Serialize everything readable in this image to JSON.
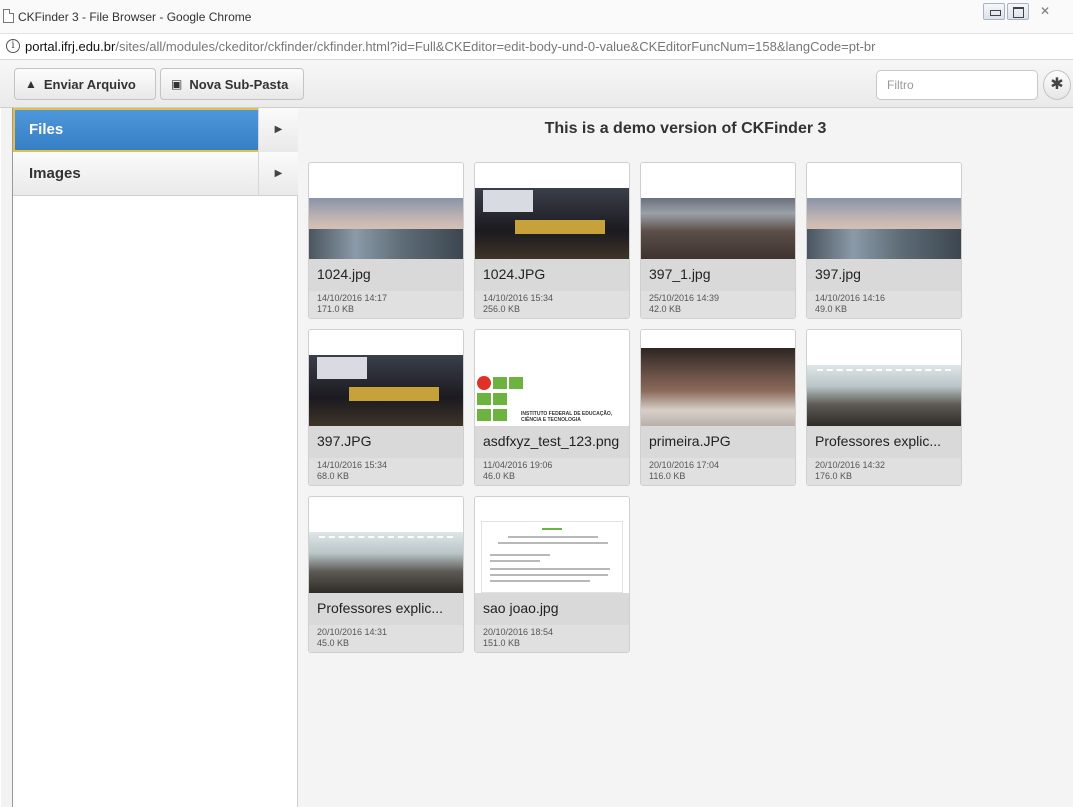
{
  "window": {
    "title": "CKFinder 3 - File Browser - Google Chrome",
    "close_glyph": "✕"
  },
  "address": {
    "host": "portal.ifrj.edu.br",
    "path": "/sites/all/modules/ckeditor/ckfinder/ckfinder.html?id=Full&CKEditor=edit-body-und-0-value&CKEditorFuncNum=158&langCode=pt-br"
  },
  "toolbar": {
    "upload_label": "Enviar Arquivo",
    "upload_icon": "upload-icon",
    "new_folder_label": "Nova Sub-Pasta",
    "new_folder_icon": "folder-add-icon",
    "filter_placeholder": "Filtro",
    "settings_icon": "gear-icon"
  },
  "sidebar": {
    "folders": [
      {
        "label": "Files",
        "active": true
      },
      {
        "label": "Images",
        "active": false
      }
    ],
    "accent_color": "#3f88cf",
    "selected_border_color": "#e2c04a"
  },
  "main": {
    "demo_message": "This is a demo version of CKFinder 3",
    "files": [
      {
        "name": "1024.jpg",
        "date": "14/10/2016 14:17",
        "size": "171.0 KB",
        "thumb": "street-photo"
      },
      {
        "name": "1024.JPG",
        "date": "14/10/2016 15:34",
        "size": "256.0 KB",
        "thumb": "auditorium-photo"
      },
      {
        "name": "397_1.jpg",
        "date": "25/10/2016 14:39",
        "size": "42.0 KB",
        "thumb": "crowd-photo"
      },
      {
        "name": "397.jpg",
        "date": "14/10/2016 14:16",
        "size": "49.0 KB",
        "thumb": "street-photo"
      },
      {
        "name": "397.JPG",
        "date": "14/10/2016 15:34",
        "size": "68.0 KB",
        "thumb": "auditorium-photo"
      },
      {
        "name": "asdfxyz_test_123.png",
        "date": "11/04/2016 19:06",
        "size": "46.0 KB",
        "thumb": "institute-logo"
      },
      {
        "name": "primeira.JPG",
        "date": "20/10/2016 17:04",
        "size": "116.0 KB",
        "thumb": "audience-photo"
      },
      {
        "name": "Professores explic...",
        "date": "20/10/2016 14:32",
        "size": "176.0 KB",
        "thumb": "gym-photo"
      },
      {
        "name": "Professores explic...",
        "date": "20/10/2016 14:31",
        "size": "45.0 KB",
        "thumb": "gym-photo"
      },
      {
        "name": "sao joao.jpg",
        "date": "20/10/2016 18:54",
        "size": "151.0 KB",
        "thumb": "document-scan"
      }
    ],
    "logo_text": "INSTITUTO FEDERAL DE EDUCAÇÃO, CIÊNCIA E TECNOLOGIA"
  }
}
